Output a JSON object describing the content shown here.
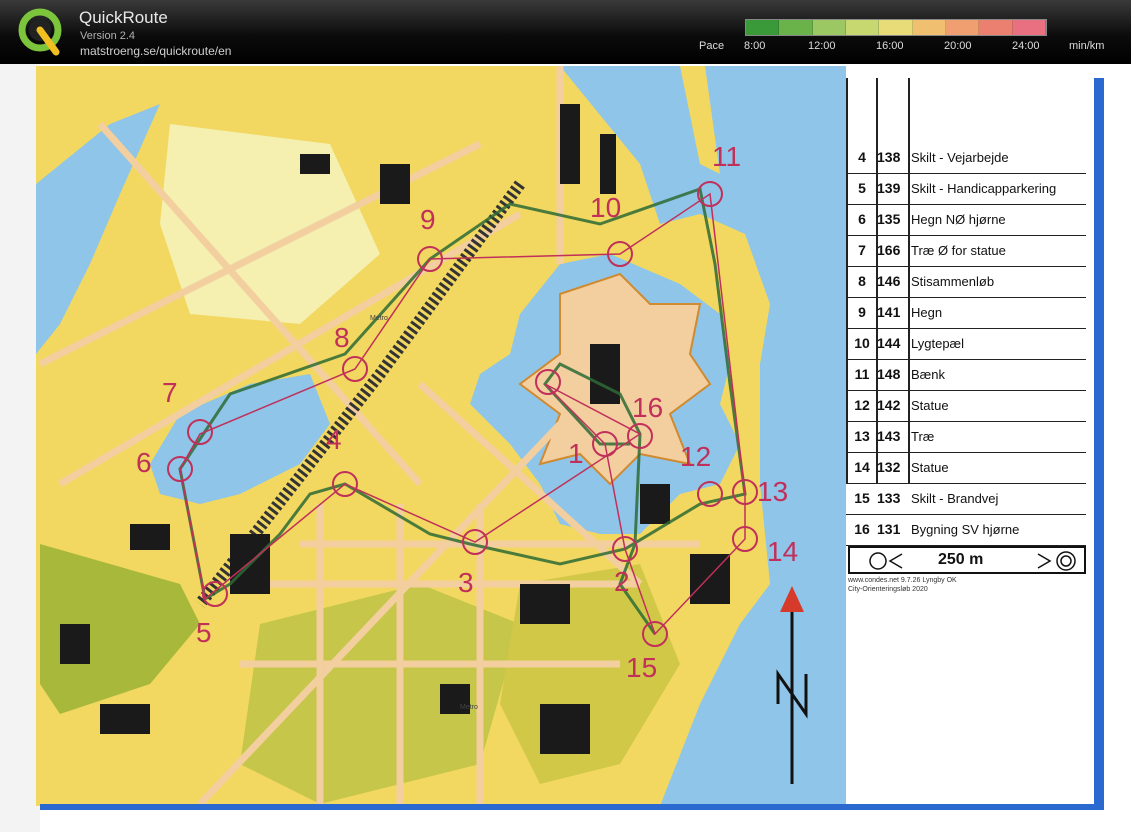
{
  "app": {
    "name": "QuickRoute",
    "version": "Version 2.4",
    "url": "matstroeng.se/quickroute/en"
  },
  "pace": {
    "label": "Pace",
    "unit": "min/km",
    "ticks": [
      "8:00",
      "12:00",
      "16:00",
      "20:00",
      "24:00"
    ],
    "colors": [
      "#3a9a3a",
      "#6ab24a",
      "#9cc864",
      "#c8d870",
      "#e8dc78",
      "#f0c070",
      "#f0a070",
      "#ec8070",
      "#e87080"
    ]
  },
  "map": {
    "colors": {
      "water": "#8ec5e8",
      "open": "#f4e24a",
      "olive": "#a8b83a",
      "paved": "#f3cfa0",
      "building": "#1a1a1a",
      "course": "#c0305a",
      "route": "#2e6b35"
    },
    "control_labels": [
      "5",
      "6",
      "7",
      "8",
      "9",
      "10",
      "11",
      "1",
      "2",
      "3",
      "4",
      "12",
      "13",
      "14",
      "15",
      "16"
    ],
    "metro_label": "Metro",
    "north_label": "N"
  },
  "legend": {
    "rows": [
      {
        "num": "4",
        "code": "138",
        "desc": "Skilt - Vejarbejde"
      },
      {
        "num": "5",
        "code": "139",
        "desc": "Skilt - Handicapparkering"
      },
      {
        "num": "6",
        "code": "135",
        "desc": "Hegn NØ hjørne"
      },
      {
        "num": "7",
        "code": "166",
        "desc": "Træ Ø for statue"
      },
      {
        "num": "8",
        "code": "146",
        "desc": "Stisammenløb"
      },
      {
        "num": "9",
        "code": "141",
        "desc": "Hegn"
      },
      {
        "num": "10",
        "code": "144",
        "desc": "Lygtepæl"
      },
      {
        "num": "11",
        "code": "148",
        "desc": "Bænk"
      },
      {
        "num": "12",
        "code": "142",
        "desc": "Statue"
      },
      {
        "num": "13",
        "code": "143",
        "desc": "Træ"
      },
      {
        "num": "14",
        "code": "132",
        "desc": "Statue"
      },
      {
        "num": "15",
        "code": "133",
        "desc": "Skilt - Brandvej"
      },
      {
        "num": "16",
        "code": "131",
        "desc": "Bygning SV hjørne"
      }
    ],
    "scale": "250 m",
    "credit_1": "www.condes.net 9.7.26 Lyngby OK",
    "credit_2": "City-Orienteringsløb 2020"
  }
}
